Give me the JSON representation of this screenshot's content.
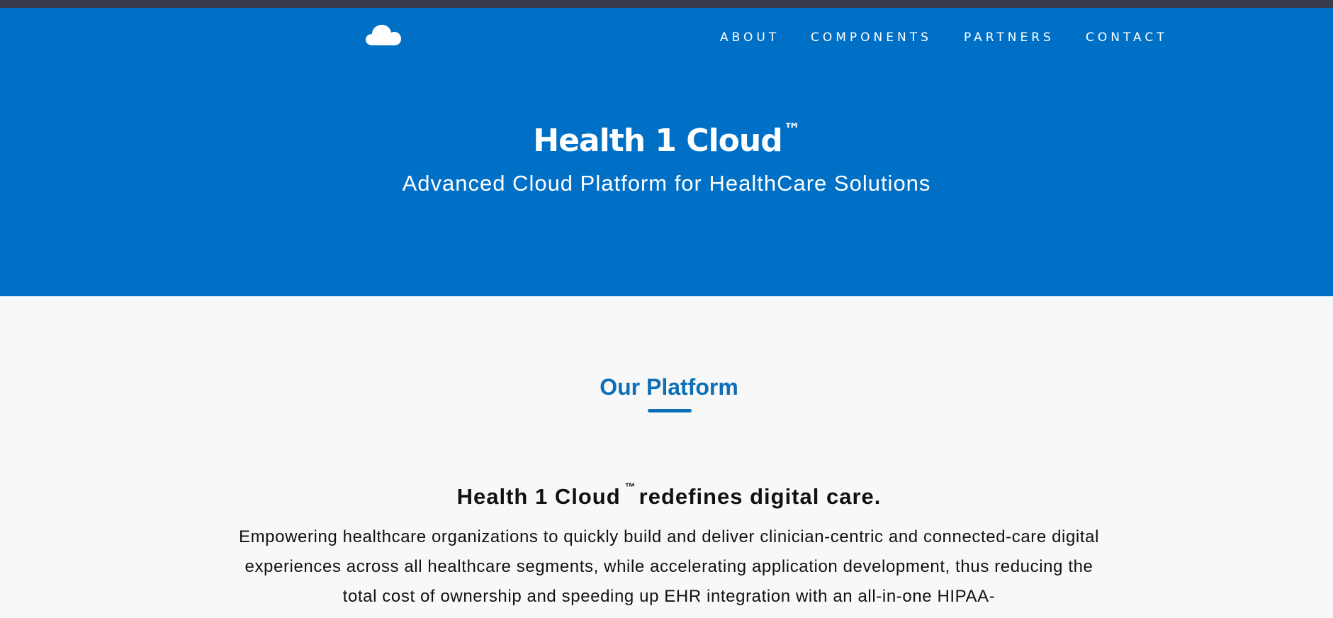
{
  "nav": {
    "logo_icon": "cloud-icon",
    "items": [
      {
        "label": "ABOUT"
      },
      {
        "label": "COMPONENTS"
      },
      {
        "label": "PARTNERS"
      },
      {
        "label": "CONTACT"
      }
    ]
  },
  "hero": {
    "title": "Health 1 Cloud",
    "trademark": "™",
    "subtitle": "Advanced Cloud Platform for HealthCare Solutions"
  },
  "platform": {
    "heading": "Our Platform",
    "tagline_name": "Health 1 Cloud",
    "tagline_trademark": "™",
    "tagline_rest": "redefines digital care.",
    "body": "Empowering healthcare organizations to quickly build and deliver clinician-centric and connected-care digital experiences across all healthcare segments, while accelerating application development, thus reducing the total cost of ownership and speeding up EHR integration with an all-in-one HIPAA-"
  },
  "colors": {
    "hero_bg": "#0070c6",
    "accent": "#0d6fb8",
    "top_strip": "#3b3a4a",
    "page_bg": "#f8f8f9"
  }
}
